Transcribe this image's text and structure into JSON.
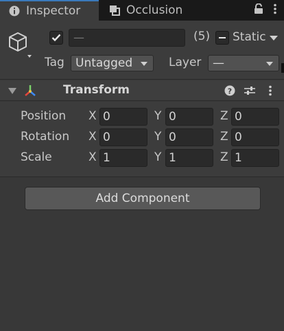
{
  "tabs": [
    {
      "label": "Inspector",
      "icon": "info-icon",
      "active": true
    },
    {
      "label": "Occlusion",
      "icon": "occlusion-icon",
      "active": false
    }
  ],
  "tabbar_icons": [
    "lock-icon",
    "more-vertical-icon"
  ],
  "header": {
    "active_checked": true,
    "name_value": "—",
    "multi_count": "(5)",
    "static_label": "Static",
    "static_checked": "mixed",
    "tag_label": "Tag",
    "tag_value": "Untagged",
    "layer_label": "Layer",
    "layer_value": "—"
  },
  "component": {
    "title": "Transform",
    "icons": [
      "help-icon",
      "presets-icon",
      "more-vertical-icon"
    ],
    "rows": [
      {
        "label": "Position",
        "x": "0",
        "y": "0",
        "z": "0"
      },
      {
        "label": "Rotation",
        "x": "0",
        "y": "0",
        "z": "0"
      },
      {
        "label": "Scale",
        "x": "1",
        "y": "1",
        "z": "1"
      }
    ],
    "axis_labels": {
      "x": "X",
      "y": "Y",
      "z": "Z"
    }
  },
  "add_component_label": "Add Component",
  "colors": {
    "background": "#383838",
    "tabbar": "#191919",
    "accent": "#3a79bb"
  }
}
